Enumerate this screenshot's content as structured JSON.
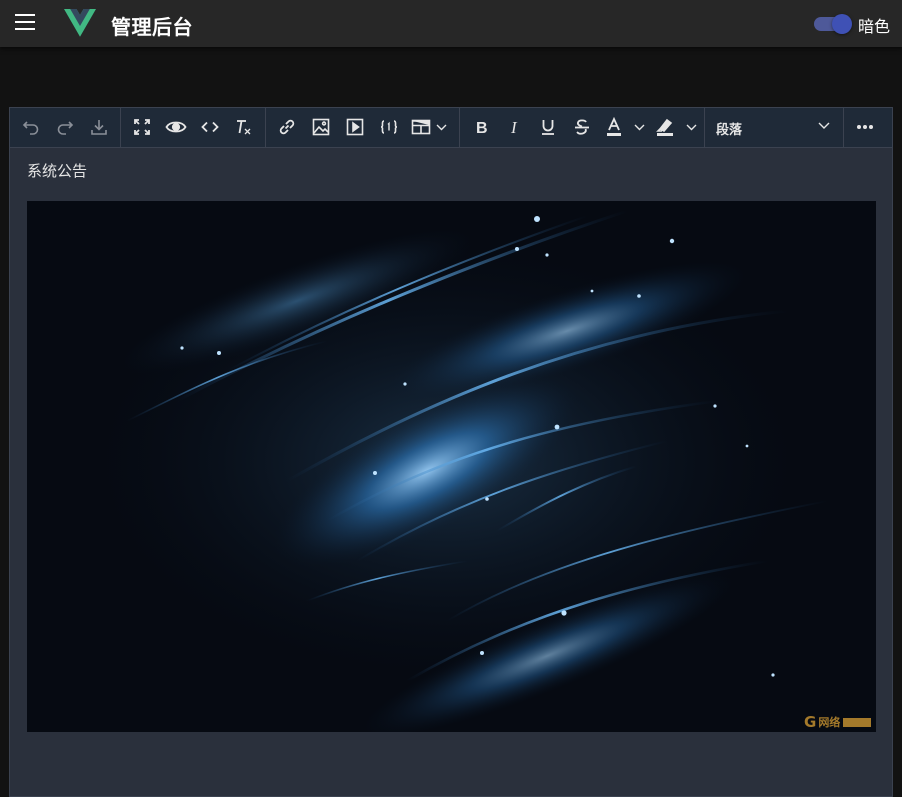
{
  "header": {
    "title": "管理后台",
    "theme_label": "暗色",
    "theme_dark_enabled": true
  },
  "toolbar": {
    "groups": [
      [
        "undo-icon",
        "redo-icon",
        "download-icon"
      ],
      [
        "fullscreen-icon",
        "preview-icon",
        "source-code-icon",
        "clear-format-icon"
      ],
      [
        "link-icon",
        "image-icon",
        "video-icon",
        "code-block-icon",
        "table-icon"
      ],
      [
        "bold-icon",
        "italic-icon",
        "underline-icon",
        "strikethrough-icon",
        "font-color-icon",
        "highlight-color-icon"
      ],
      [
        "more-icon"
      ]
    ],
    "format_value": "段落"
  },
  "content": {
    "notice_title": "系统公告",
    "watermark_letter": "G",
    "watermark_text": "网络"
  },
  "colors": {
    "accent": "#3f51b5",
    "vue_green": "#41b883",
    "vue_dark": "#34495e",
    "editor_bg": "#2a303c",
    "toolbar_bg": "#1f2a38"
  }
}
